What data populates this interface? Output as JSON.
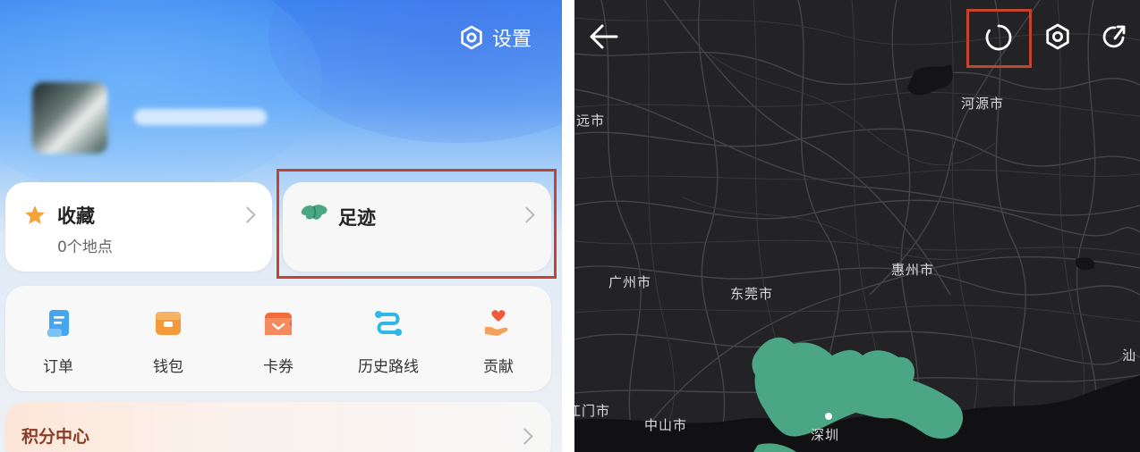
{
  "left_panel": {
    "settings_label": "设置",
    "favorites": {
      "title": "收藏",
      "subtitle": "0个地点"
    },
    "footprint": {
      "title": "足迹"
    },
    "menu": [
      {
        "label": "订单",
        "icon": "order-icon"
      },
      {
        "label": "钱包",
        "icon": "wallet-icon"
      },
      {
        "label": "卡券",
        "icon": "coupon-icon"
      },
      {
        "label": "历史路线",
        "icon": "route-history-icon"
      },
      {
        "label": "贡献",
        "icon": "contribute-icon"
      }
    ],
    "points_center": "积分中心"
  },
  "right_panel": {
    "cities": {
      "heyuan": "河源市",
      "qingyuan_partial": "远市",
      "guangzhou": "广州市",
      "dongguan": "东莞市",
      "huizhou": "惠州市",
      "jiangmen_partial": "江门市",
      "zhongshan": "中山市",
      "shenzhen": "深圳",
      "shanwei_partial": "汕"
    },
    "visited_region_color": "#4aa684",
    "highlight_color": "#c0442e"
  }
}
